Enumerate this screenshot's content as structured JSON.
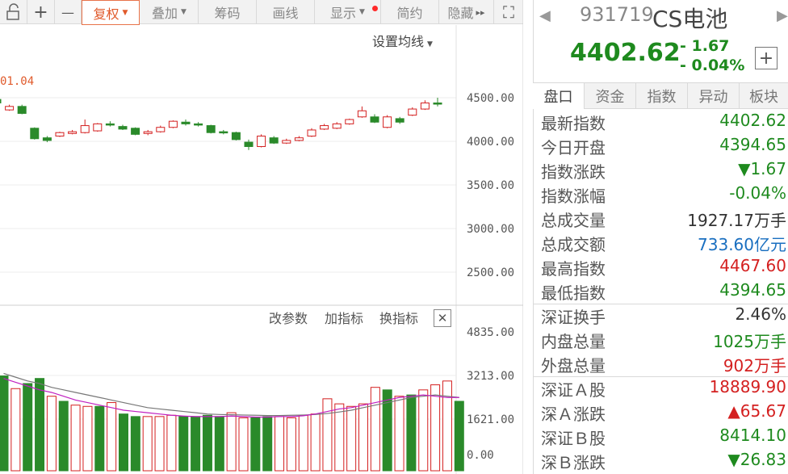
{
  "toolbar": {
    "items": [
      {
        "label": "复权",
        "active": true,
        "caret": true
      },
      {
        "label": "叠加",
        "caret": true
      },
      {
        "label": "筹码"
      },
      {
        "label": "画线"
      },
      {
        "label": "显示",
        "caret": true,
        "dot": true
      },
      {
        "label": "简约"
      },
      {
        "label": "隐藏",
        "suffix": "▸▸"
      }
    ],
    "plus": "+",
    "minus": "—",
    "expand": "⛶"
  },
  "main_chart": {
    "ma_setting": "设置均线",
    "date_label": "01.04",
    "y_ticks": [
      "4500.00",
      "4000.00",
      "3500.00",
      "3000.00",
      "2500.00"
    ],
    "candles": [
      {
        "o": 4480,
        "c": 4440,
        "h": 4530,
        "l": 4430
      },
      {
        "o": 4360,
        "c": 4400,
        "h": 4420,
        "l": 4350
      },
      {
        "o": 4400,
        "c": 4320,
        "h": 4420,
        "l": 4310
      },
      {
        "o": 4150,
        "c": 4030,
        "h": 4160,
        "l": 4020
      },
      {
        "o": 4040,
        "c": 4010,
        "h": 4060,
        "l": 3990
      },
      {
        "o": 4060,
        "c": 4100,
        "h": 4110,
        "l": 4050
      },
      {
        "o": 4090,
        "c": 4110,
        "h": 4130,
        "l": 4080
      },
      {
        "o": 4100,
        "c": 4180,
        "h": 4250,
        "l": 4090
      },
      {
        "o": 4120,
        "c": 4200,
        "h": 4210,
        "l": 4110
      },
      {
        "o": 4200,
        "c": 4190,
        "h": 4230,
        "l": 4170
      },
      {
        "o": 4170,
        "c": 4140,
        "h": 4190,
        "l": 4130
      },
      {
        "o": 4150,
        "c": 4080,
        "h": 4160,
        "l": 4070
      },
      {
        "o": 4090,
        "c": 4110,
        "h": 4130,
        "l": 4070
      },
      {
        "o": 4110,
        "c": 4160,
        "h": 4180,
        "l": 4100
      },
      {
        "o": 4160,
        "c": 4230,
        "h": 4240,
        "l": 4150
      },
      {
        "o": 4220,
        "c": 4200,
        "h": 4250,
        "l": 4180
      },
      {
        "o": 4200,
        "c": 4190,
        "h": 4220,
        "l": 4170
      },
      {
        "o": 4180,
        "c": 4100,
        "h": 4190,
        "l": 4090
      },
      {
        "o": 4110,
        "c": 4100,
        "h": 4130,
        "l": 4080
      },
      {
        "o": 4100,
        "c": 4020,
        "h": 4110,
        "l": 4010
      },
      {
        "o": 3990,
        "c": 3940,
        "h": 4020,
        "l": 3900
      },
      {
        "o": 3940,
        "c": 4060,
        "h": 4080,
        "l": 3930
      },
      {
        "o": 4040,
        "c": 3980,
        "h": 4060,
        "l": 3970
      },
      {
        "o": 3980,
        "c": 4010,
        "h": 4030,
        "l": 3970
      },
      {
        "o": 4010,
        "c": 4040,
        "h": 4060,
        "l": 4000
      },
      {
        "o": 4060,
        "c": 4130,
        "h": 4150,
        "l": 4050
      },
      {
        "o": 4140,
        "c": 4180,
        "h": 4200,
        "l": 4130
      },
      {
        "o": 4150,
        "c": 4200,
        "h": 4220,
        "l": 4140
      },
      {
        "o": 4200,
        "c": 4250,
        "h": 4260,
        "l": 4190
      },
      {
        "o": 4280,
        "c": 4350,
        "h": 4400,
        "l": 4270
      },
      {
        "o": 4280,
        "c": 4220,
        "h": 4310,
        "l": 4210
      },
      {
        "o": 4160,
        "c": 4280,
        "h": 4300,
        "l": 4150
      },
      {
        "o": 4260,
        "c": 4220,
        "h": 4280,
        "l": 4200
      },
      {
        "o": 4300,
        "c": 4370,
        "h": 4390,
        "l": 4290
      },
      {
        "o": 4370,
        "c": 4440,
        "h": 4470,
        "l": 4360
      },
      {
        "o": 4440,
        "c": 4430,
        "h": 4500,
        "l": 4400
      }
    ]
  },
  "vol_chart": {
    "actions": [
      "改参数",
      "加指标",
      "换指标"
    ],
    "close": "✕",
    "y_ticks": [
      "4835.00",
      "3213.00",
      "1621.00",
      "0.00"
    ],
    "volumes": [
      3100,
      2600,
      2800,
      3000,
      2300,
      2100,
      1950,
      1900,
      1900,
      2050,
      1600,
      1500,
      1500,
      1500,
      1550,
      1500,
      1500,
      1550,
      1500,
      1650,
      1450,
      1450,
      1500,
      1500,
      1450,
      1550,
      1600,
      2200,
      2000,
      1900,
      2000,
      2650,
      2550,
      2300,
      2350,
      2550,
      2750,
      2900,
      2100
    ],
    "rising": [
      false,
      true,
      false,
      false,
      true,
      false,
      true,
      true,
      false,
      true,
      false,
      false,
      true,
      true,
      true,
      false,
      false,
      false,
      false,
      true,
      true,
      false,
      false,
      true,
      true,
      true,
      true,
      true,
      true,
      true,
      true,
      true,
      false,
      true,
      false,
      true,
      true,
      true,
      false
    ],
    "ma1": [
      3000,
      2850,
      2700,
      2550,
      2450,
      2300,
      2150,
      2050,
      1950,
      1850,
      1750,
      1700,
      1650,
      1600,
      1550,
      1520,
      1500,
      1500,
      1500,
      1520,
      1500,
      1480,
      1480,
      1500,
      1500,
      1530,
      1600,
      1700,
      1800,
      1850,
      1950,
      2050,
      2150,
      2250,
      2300,
      2350,
      2300,
      2250,
      2250
    ],
    "ma2": [
      3200,
      3050,
      2900,
      2800,
      2650,
      2550,
      2450,
      2350,
      2250,
      2150,
      2050,
      1950,
      1850,
      1800,
      1750,
      1700,
      1650,
      1600,
      1580,
      1570,
      1560,
      1550,
      1540,
      1540,
      1550,
      1560,
      1580,
      1620,
      1680,
      1750,
      1850,
      1950,
      2050,
      2150,
      2250,
      2300,
      2350,
      2300,
      2250
    ]
  },
  "info": {
    "code": "931719",
    "name": "CS电池",
    "price": "4402.62",
    "change": "- 1.67",
    "change_pct": "- 0.04%",
    "add": "+",
    "nav_left": "◀",
    "nav_right": "▶",
    "tabs": [
      "盘口",
      "资金",
      "指数",
      "异动",
      "板块"
    ],
    "rows": [
      {
        "label": "最新指数",
        "value": "4402.62",
        "color": "green"
      },
      {
        "label": "今日开盘",
        "value": "4394.65",
        "color": "green"
      },
      {
        "label": "指数涨跌",
        "value": "▼1.67",
        "color": "green"
      },
      {
        "label": "指数涨幅",
        "value": "-0.04%",
        "color": "green"
      },
      {
        "label": "总成交量",
        "value": "1927.17万手",
        "color": "dark"
      },
      {
        "label": "总成交额",
        "value": "733.60亿元",
        "color": "blue"
      },
      {
        "label": "最高指数",
        "value": "4467.60",
        "color": "red"
      },
      {
        "label": "最低指数",
        "value": "4394.65",
        "color": "green"
      },
      {
        "label": "深证换手",
        "value": "2.46%",
        "color": "dark"
      },
      {
        "label": "内盘总量",
        "value": "1025万手",
        "color": "green"
      },
      {
        "label": "外盘总量",
        "value": "902万手",
        "color": "red"
      },
      {
        "label": "深证Ａ股",
        "value": "18889.90",
        "color": "red"
      },
      {
        "label": "深Ａ涨跌",
        "value": "▲65.67",
        "color": "red"
      },
      {
        "label": "深证Ｂ股",
        "value": "8414.10",
        "color": "green"
      },
      {
        "label": "深Ｂ涨跌",
        "value": "▼26.83",
        "color": "green"
      }
    ]
  }
}
